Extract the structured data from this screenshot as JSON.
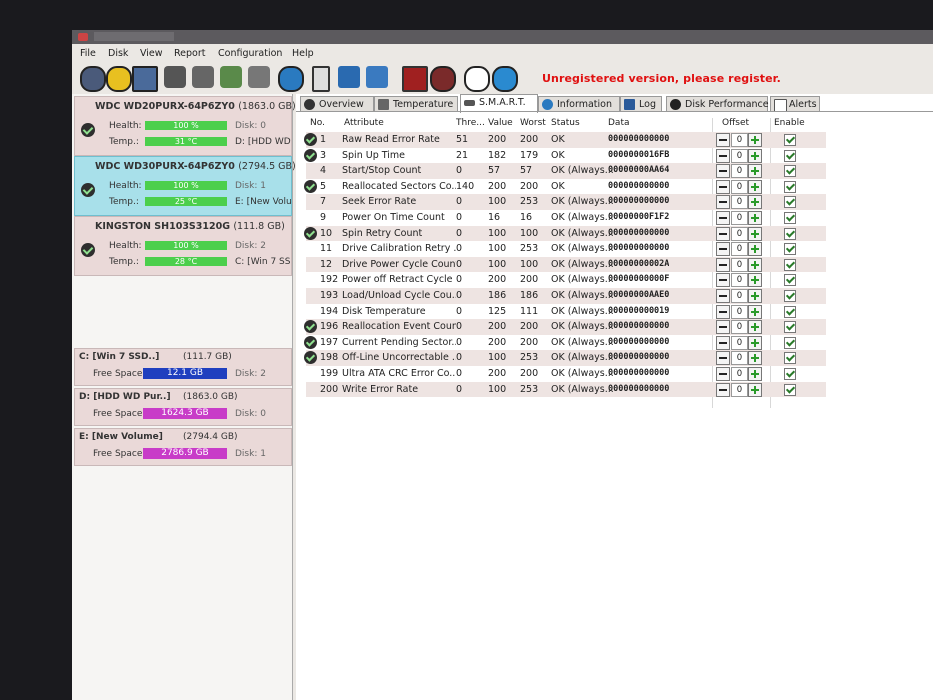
{
  "menu": [
    "File",
    "Disk",
    "View",
    "Report",
    "Configuration",
    "Help"
  ],
  "toolbar": {
    "icons": [
      "refresh-icon",
      "warning-icon",
      "screen-icon",
      "disk-tool-1-icon",
      "disk-tool-2-icon",
      "disk-tool-3-icon",
      "disk-tool-4-icon",
      "globe-icon",
      "document-icon",
      "sync-icon",
      "world-icon",
      "monitor-icon",
      "settings-icon",
      "help-icon",
      "info-icon"
    ],
    "warning": "Unregistered version, please register."
  },
  "disks": [
    {
      "name": "WDC WD20PURX-64P6ZY0",
      "size": "(1863.0 GB)",
      "health_label": "Health:",
      "health": "100 %",
      "health_level": 100,
      "temp_label": "Temp.:",
      "temp": "31 °C",
      "disk": "Disk: 0",
      "mount": "D: [HDD WD"
    },
    {
      "name": "WDC WD30PURX-64P6ZY0",
      "size": "(2794.5 GB)",
      "health_label": "Health:",
      "health": "100 %",
      "health_level": 100,
      "temp_label": "Temp.:",
      "temp": "25 °C",
      "disk": "Disk: 1",
      "mount": "E: [New Volu"
    },
    {
      "name": "KINGSTON SH103S3120G",
      "size": "(111.8 GB)",
      "health_label": "Health:",
      "health": "100 %",
      "health_level": 100,
      "temp_label": "Temp.:",
      "temp": "28 °C",
      "disk": "Disk: 2",
      "mount": "C: [Win 7 SSD"
    }
  ],
  "volumes": [
    {
      "name": "C: [Win 7 SSD..]",
      "size": "(111.7 GB)",
      "free_label": "Free Space",
      "free": "12.1 GB",
      "disk": "Disk: 2",
      "color": "#1f3fbf"
    },
    {
      "name": "D: [HDD WD Pur..]",
      "size": "(1863.0 GB)",
      "free_label": "Free Space",
      "free": "1624.3 GB",
      "disk": "Disk: 0",
      "color": "#c83cc8"
    },
    {
      "name": "E: [New Volume]",
      "size": "(2794.4 GB)",
      "free_label": "Free Space",
      "free": "2786.9 GB",
      "disk": "Disk: 1",
      "color": "#c83cc8"
    }
  ],
  "tabs": [
    "Overview",
    "Temperature",
    "S.M.A.R.T.",
    "Information",
    "Log",
    "Disk Performance",
    "Alerts"
  ],
  "active_tab": "S.M.A.R.T.",
  "columns": {
    "no": "No.",
    "attribute": "Attribute",
    "threshold": "Thre...",
    "value": "Value",
    "worst": "Worst",
    "status": "Status",
    "data": "Data",
    "offset": "Offset",
    "enable": "Enable"
  },
  "smart_rows": [
    {
      "no": "1",
      "attr": "Raw Read Error Rate",
      "thr": "51",
      "val": "200",
      "worst": "200",
      "status": "OK",
      "data": "000000000000",
      "offset": "0",
      "ok_icon": true
    },
    {
      "no": "3",
      "attr": "Spin Up Time",
      "thr": "21",
      "val": "182",
      "worst": "179",
      "status": "OK",
      "data": "0000000016FB",
      "offset": "0",
      "ok_icon": true
    },
    {
      "no": "4",
      "attr": "Start/Stop Count",
      "thr": "0",
      "val": "57",
      "worst": "57",
      "status": "OK (Always...",
      "data": "00000000AA64",
      "offset": "0",
      "ok_icon": false
    },
    {
      "no": "5",
      "attr": "Reallocated Sectors Co...",
      "thr": "140",
      "val": "200",
      "worst": "200",
      "status": "OK",
      "data": "000000000000",
      "offset": "0",
      "ok_icon": true
    },
    {
      "no": "7",
      "attr": "Seek Error Rate",
      "thr": "0",
      "val": "100",
      "worst": "253",
      "status": "OK (Always...",
      "data": "000000000000",
      "offset": "0",
      "ok_icon": false
    },
    {
      "no": "9",
      "attr": "Power On Time Count",
      "thr": "0",
      "val": "16",
      "worst": "16",
      "status": "OK (Always...",
      "data": "00000000F1F2",
      "offset": "0",
      "ok_icon": false
    },
    {
      "no": "10",
      "attr": "Spin Retry Count",
      "thr": "0",
      "val": "100",
      "worst": "100",
      "status": "OK (Always...",
      "data": "000000000000",
      "offset": "0",
      "ok_icon": true
    },
    {
      "no": "11",
      "attr": "Drive Calibration Retry ...",
      "thr": "0",
      "val": "100",
      "worst": "253",
      "status": "OK (Always...",
      "data": "000000000000",
      "offset": "0",
      "ok_icon": false
    },
    {
      "no": "12",
      "attr": "Drive Power Cycle Count",
      "thr": "0",
      "val": "100",
      "worst": "100",
      "status": "OK (Always...",
      "data": "00000000002A",
      "offset": "0",
      "ok_icon": false
    },
    {
      "no": "192",
      "attr": "Power off Retract Cycle ...",
      "thr": "0",
      "val": "200",
      "worst": "200",
      "status": "OK (Always...",
      "data": "00000000000F",
      "offset": "0",
      "ok_icon": false
    },
    {
      "no": "193",
      "attr": "Load/Unload Cycle Cou...",
      "thr": "0",
      "val": "186",
      "worst": "186",
      "status": "OK (Always...",
      "data": "00000000AAE0",
      "offset": "0",
      "ok_icon": false
    },
    {
      "no": "194",
      "attr": "Disk Temperature",
      "thr": "0",
      "val": "125",
      "worst": "111",
      "status": "OK (Always...",
      "data": "000000000019",
      "offset": "0",
      "ok_icon": false
    },
    {
      "no": "196",
      "attr": "Reallocation Event Count",
      "thr": "0",
      "val": "200",
      "worst": "200",
      "status": "OK (Always...",
      "data": "000000000000",
      "offset": "0",
      "ok_icon": true
    },
    {
      "no": "197",
      "attr": "Current Pending Sector...",
      "thr": "0",
      "val": "200",
      "worst": "200",
      "status": "OK (Always...",
      "data": "000000000000",
      "offset": "0",
      "ok_icon": true
    },
    {
      "no": "198",
      "attr": "Off-Line Uncorrectable ...",
      "thr": "0",
      "val": "100",
      "worst": "253",
      "status": "OK (Always...",
      "data": "000000000000",
      "offset": "0",
      "ok_icon": true
    },
    {
      "no": "199",
      "attr": "Ultra ATA CRC Error Co...",
      "thr": "0",
      "val": "200",
      "worst": "200",
      "status": "OK (Always...",
      "data": "000000000000",
      "offset": "0",
      "ok_icon": false
    },
    {
      "no": "200",
      "attr": "Write Error Rate",
      "thr": "0",
      "val": "100",
      "worst": "253",
      "status": "OK (Always...",
      "data": "000000000000",
      "offset": "0",
      "ok_icon": false
    }
  ]
}
